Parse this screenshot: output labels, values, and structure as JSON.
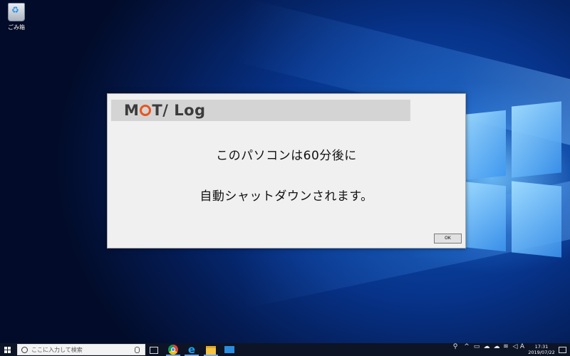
{
  "desktop": {
    "icons": [
      {
        "label": "ごみ箱",
        "icon": "recycle-bin-icon"
      }
    ]
  },
  "dialog": {
    "brand_left": "M",
    "brand_right": "T/ Log",
    "message_line1": "このパソコンは60分後に",
    "message_line2": "自動シャットダウンされます。",
    "ok_label": "OK",
    "colors": {
      "background": "#f0f0f0",
      "banner": "#d4d4d4",
      "brand_accent": "#e8561e"
    }
  },
  "taskbar": {
    "search_placeholder": "ここに入力して検索",
    "pinned_apps": [
      "task-view-icon",
      "chrome-icon",
      "internet-explorer-icon",
      "file-explorer-icon",
      "store-icon"
    ],
    "tray": {
      "ime_indicator": "A",
      "time": "17:31",
      "date": "2019/07/22"
    }
  }
}
